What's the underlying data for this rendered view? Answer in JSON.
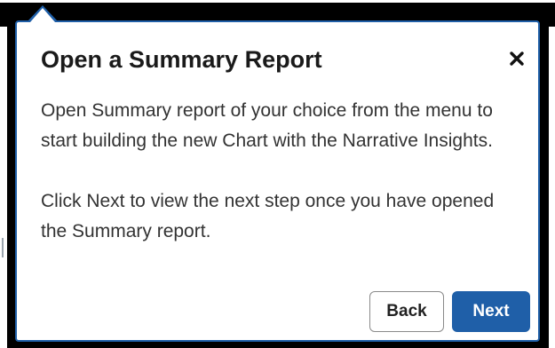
{
  "popover": {
    "title": "Open a Summary Report",
    "paragraphs": [
      "Open Summary report of your choice from the menu to start building the new Chart with the Narrative Insights.",
      "Click Next to view the next step once you have opened the Summary report."
    ],
    "back_label": "Back",
    "next_label": "Next",
    "close_icon": "close-icon"
  },
  "colors": {
    "accent": "#1f5fa8",
    "border": "#1f5fa8",
    "backdrop": "#000000",
    "text": "#333333"
  }
}
